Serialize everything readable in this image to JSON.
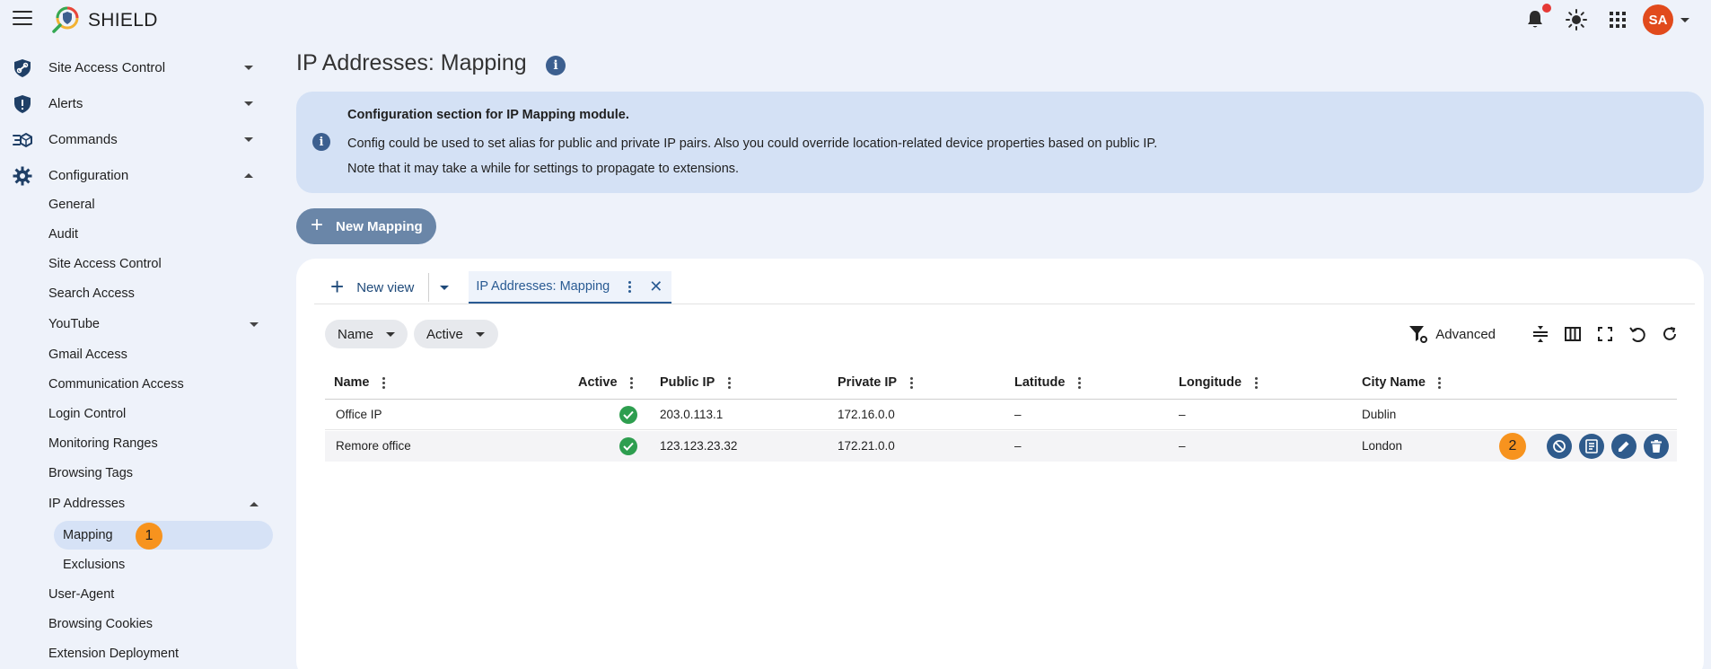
{
  "app": {
    "brand": "SHIELD",
    "avatar_initials": "SA"
  },
  "sidebar": {
    "groups": [
      {
        "label": "Site Access Control",
        "icon": "shield-link-icon"
      },
      {
        "label": "Alerts",
        "icon": "alert-shield-icon"
      },
      {
        "label": "Commands",
        "icon": "commands-icon"
      },
      {
        "label": "Configuration",
        "icon": "gear-icon"
      }
    ],
    "config_items": [
      "General",
      "Audit",
      "Site Access Control",
      "Search Access",
      "YouTube",
      "Gmail Access",
      "Communication Access",
      "Login Control",
      "Monitoring Ranges",
      "Browsing Tags",
      "IP Addresses",
      "User-Agent",
      "Browsing Cookies",
      "Extension Deployment"
    ],
    "ip_sub_items": [
      "Mapping",
      "Exclusions"
    ],
    "active_item": "Mapping",
    "active_badge": "1"
  },
  "page": {
    "title": "IP Addresses: Mapping",
    "info": {
      "line1": "Configuration section for IP Mapping module.",
      "line2": "Config could be used to set alias for public and private IP pairs. Also you could override location-related device properties based on public IP.",
      "line3": "Note that it may take a while for settings to propagate to extensions."
    },
    "new_mapping_label": "New Mapping"
  },
  "grid": {
    "new_view_label": "New view",
    "active_tab_label": "IP Addresses: Mapping",
    "filters": [
      "Name",
      "Active"
    ],
    "advanced_label": "Advanced",
    "columns": [
      "Name",
      "Active",
      "Public IP",
      "Private IP",
      "Latitude",
      "Longitude",
      "City Name"
    ],
    "rows": [
      {
        "name": "Office IP",
        "active": true,
        "public_ip": "203.0.113.1",
        "private_ip": "172.16.0.0",
        "latitude": "–",
        "longitude": "–",
        "city": "Dublin"
      },
      {
        "name": "Remore office",
        "active": true,
        "public_ip": "123.123.23.32",
        "private_ip": "172.21.0.0",
        "latitude": "–",
        "longitude": "–",
        "city": "London"
      }
    ],
    "row_badge": "2"
  },
  "colors": {
    "accent": "#2f5b8c",
    "info_bg": "#d4e1f5",
    "avatar": "#e14a1c",
    "badge": "#f7931e",
    "success": "#2e9e4f"
  }
}
